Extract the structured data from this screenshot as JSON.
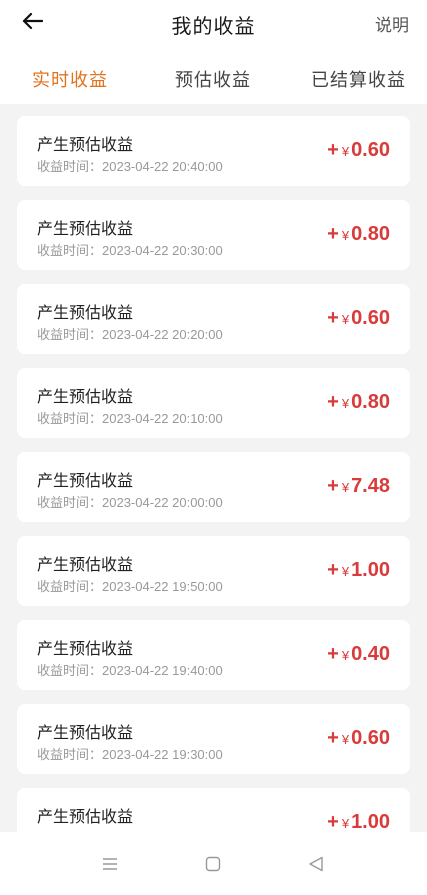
{
  "header": {
    "title": "我的收益",
    "explain_label": "说明"
  },
  "tabs": [
    {
      "label": "实时收益",
      "active": true
    },
    {
      "label": "预估收益",
      "active": false
    },
    {
      "label": "已结算收益",
      "active": false
    }
  ],
  "records": [
    {
      "title": "产生预估收益",
      "time_prefix": "收益时间：",
      "time": "2023-04-22 20:40:00",
      "sign": "+",
      "currency": "¥",
      "amount": "0.60"
    },
    {
      "title": "产生预估收益",
      "time_prefix": "收益时间：",
      "time": "2023-04-22 20:30:00",
      "sign": "+",
      "currency": "¥",
      "amount": "0.80"
    },
    {
      "title": "产生预估收益",
      "time_prefix": "收益时间：",
      "time": "2023-04-22 20:20:00",
      "sign": "+",
      "currency": "¥",
      "amount": "0.60"
    },
    {
      "title": "产生预估收益",
      "time_prefix": "收益时间：",
      "time": "2023-04-22 20:10:00",
      "sign": "+",
      "currency": "¥",
      "amount": "0.80"
    },
    {
      "title": "产生预估收益",
      "time_prefix": "收益时间：",
      "time": "2023-04-22 20:00:00",
      "sign": "+",
      "currency": "¥",
      "amount": "7.48"
    },
    {
      "title": "产生预估收益",
      "time_prefix": "收益时间：",
      "time": "2023-04-22 19:50:00",
      "sign": "+",
      "currency": "¥",
      "amount": "1.00"
    },
    {
      "title": "产生预估收益",
      "time_prefix": "收益时间：",
      "time": "2023-04-22 19:40:00",
      "sign": "+",
      "currency": "¥",
      "amount": "0.40"
    },
    {
      "title": "产生预估收益",
      "time_prefix": "收益时间：",
      "time": "2023-04-22 19:30:00",
      "sign": "+",
      "currency": "¥",
      "amount": "0.60"
    },
    {
      "title": "产生预估收益",
      "time_prefix": "",
      "time": "",
      "sign": "+",
      "currency": "¥",
      "amount": "1.00"
    }
  ],
  "colors": {
    "accent": "#e0731e",
    "amount": "#d93a3a",
    "list_bg": "#f3f3f3"
  },
  "icons": {
    "back": "arrow-left-icon",
    "menu": "menu-lines-icon",
    "home": "square-home-icon",
    "back_nav": "triangle-back-icon"
  }
}
